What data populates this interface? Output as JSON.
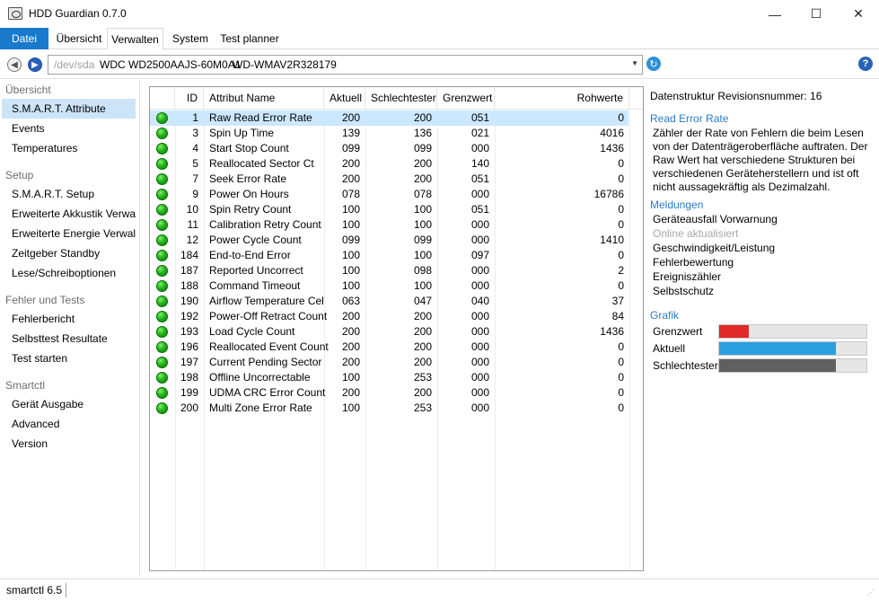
{
  "window": {
    "title": "HDD Guardian 0.7.0",
    "minimize": "—",
    "maximize": "☐",
    "close": "✕"
  },
  "menu": {
    "file": "Datei",
    "items": [
      "Übersicht",
      "Verwalten",
      "System",
      "Test planner"
    ]
  },
  "address": {
    "device": "/dev/sda",
    "model": "WDC WD2500AAJS-60M0A1",
    "serial": "WD-WMAV2R328179"
  },
  "sidebar": {
    "groups": [
      {
        "label": "Übersicht",
        "items": [
          "S.M.A.R.T. Attribute",
          "Events",
          "Temperatures"
        ]
      },
      {
        "label": "Setup",
        "items": [
          "S.M.A.R.T. Setup",
          "Erweiterte Akkustik Verwaltung",
          "Erweiterte Energie Verwaltung",
          "Zeitgeber Standby",
          "Lese/Schreiboptionen"
        ]
      },
      {
        "label": "Fehler und Tests",
        "items": [
          "Fehlerbericht",
          "Selbsttest Resultate",
          "Test starten"
        ]
      },
      {
        "label": "Smartctl",
        "items": [
          "Gerät Ausgabe",
          "Advanced",
          "Version"
        ]
      }
    ]
  },
  "table": {
    "headers": [
      "ID",
      "Attribut Name",
      "Aktuell",
      "Schlechtester",
      "Grenzwert",
      "Rohwerte"
    ],
    "rows": [
      [
        "1",
        "Raw Read Error Rate",
        "200",
        "200",
        "051",
        "0"
      ],
      [
        "3",
        "Spin Up Time",
        "139",
        "136",
        "021",
        "4016"
      ],
      [
        "4",
        "Start Stop Count",
        "099",
        "099",
        "000",
        "1436"
      ],
      [
        "5",
        "Reallocated Sector Ct",
        "200",
        "200",
        "140",
        "0"
      ],
      [
        "7",
        "Seek Error Rate",
        "200",
        "200",
        "051",
        "0"
      ],
      [
        "9",
        "Power On Hours",
        "078",
        "078",
        "000",
        "16786"
      ],
      [
        "10",
        "Spin Retry Count",
        "100",
        "100",
        "051",
        "0"
      ],
      [
        "11",
        "Calibration Retry Count",
        "100",
        "100",
        "000",
        "0"
      ],
      [
        "12",
        "Power Cycle Count",
        "099",
        "099",
        "000",
        "1410"
      ],
      [
        "184",
        "End-to-End Error",
        "100",
        "100",
        "097",
        "0"
      ],
      [
        "187",
        "Reported Uncorrect",
        "100",
        "098",
        "000",
        "2"
      ],
      [
        "188",
        "Command Timeout",
        "100",
        "100",
        "000",
        "0"
      ],
      [
        "190",
        "Airflow Temperature Cel",
        "063",
        "047",
        "040",
        "37"
      ],
      [
        "192",
        "Power-Off Retract Count",
        "200",
        "200",
        "000",
        "84"
      ],
      [
        "193",
        "Load Cycle Count",
        "200",
        "200",
        "000",
        "1436"
      ],
      [
        "196",
        "Reallocated Event Count",
        "200",
        "200",
        "000",
        "0"
      ],
      [
        "197",
        "Current Pending Sector",
        "200",
        "200",
        "000",
        "0"
      ],
      [
        "198",
        "Offline Uncorrectable",
        "100",
        "253",
        "000",
        "0"
      ],
      [
        "199",
        "UDMA CRC Error Count",
        "200",
        "200",
        "000",
        "0"
      ],
      [
        "200",
        "Multi Zone Error Rate",
        "100",
        "253",
        "000",
        "0"
      ]
    ]
  },
  "info": {
    "revision": "Datenstruktur Revisionsnummer: 16",
    "attr_title": "Read Error Rate",
    "attr_desc": "Zähler der Rate von Fehlern die beim Lesen von der Datenträgeroberfläche auftraten. Der Raw Wert hat verschiedene Strukturen bei verschiedenen Geräteherstellern und ist oft nicht aussagekräftig als Dezimalzahl.",
    "messages_title": "Meldungen",
    "messages": [
      {
        "text": "Geräteausfall Vorwarnung",
        "enabled": true
      },
      {
        "text": "Online aktualisiert",
        "enabled": false
      },
      {
        "text": "Geschwindigkeit/Leistung",
        "enabled": true
      },
      {
        "text": "Fehlerbewertung",
        "enabled": true
      },
      {
        "text": "Ereigniszähler",
        "enabled": true
      },
      {
        "text": "Selbstschutz",
        "enabled": true
      }
    ],
    "graph_title": "Grafik",
    "bars": [
      {
        "label": "Grenzwert",
        "value": 51,
        "max": 255,
        "color": "#e02a2a"
      },
      {
        "label": "Aktuell",
        "value": 200,
        "max": 253,
        "color": "#2a9fe0"
      },
      {
        "label": "Schlechtester",
        "value": 200,
        "max": 253,
        "color": "#606060"
      }
    ]
  },
  "status": {
    "text": "smartctl 6.5"
  },
  "colors": {
    "accent": "#1979ca",
    "selection": "#cce8ff",
    "section": "#2a7ac8"
  }
}
